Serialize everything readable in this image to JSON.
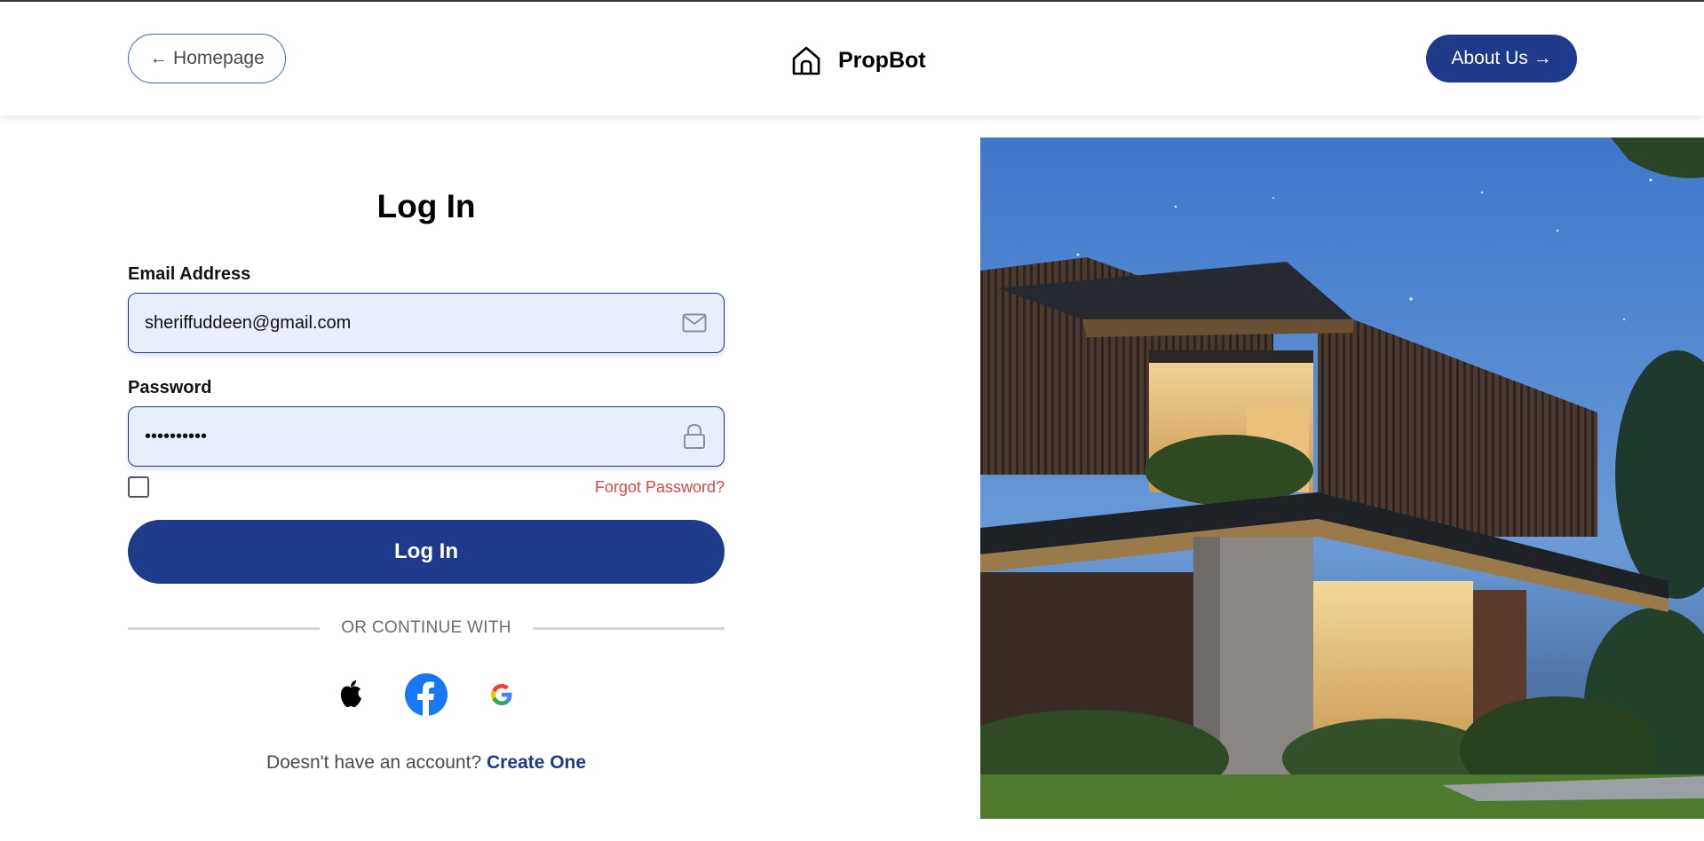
{
  "header": {
    "homepage_label": "← Homepage",
    "brand_name": "PropBot",
    "brand_icon": "house-icon",
    "about_label": "About Us →"
  },
  "login": {
    "title": "Log In",
    "email_label": "Email Address",
    "email_value": "sheriffuddeen@gmail.com",
    "email_icon": "envelope-icon",
    "password_label": "Password",
    "password_value": "••••••••••",
    "password_icon": "lock-icon",
    "remember_checked": false,
    "forgot_label": "Forgot Password?",
    "submit_label": "Log In",
    "or_text": "OR CONTINUE WITH",
    "social": [
      "apple-icon",
      "facebook-icon",
      "google-icon"
    ],
    "signup_text": "Doesn't have an account?",
    "signup_link": "Create One"
  },
  "colors": {
    "primary": "#1e3a8a",
    "field_bg": "#e8eefc",
    "forgot": "#e0453f"
  }
}
